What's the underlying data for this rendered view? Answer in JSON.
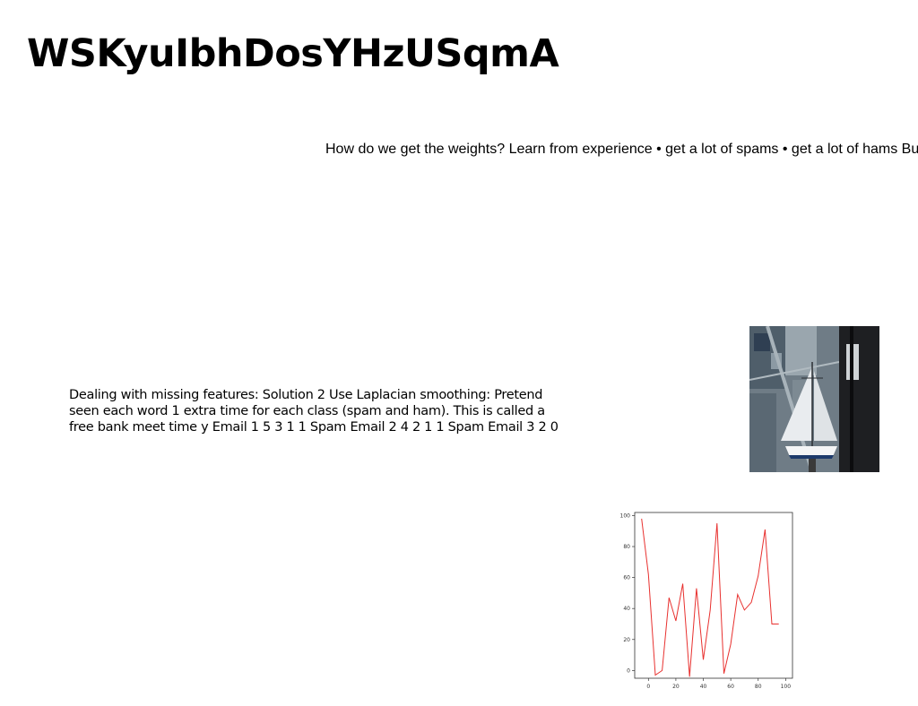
{
  "slide": {
    "title": "WSKyuIbhDosYHzUSqmA",
    "subtitle": "How do we get the weights? Learn from experience • get a lot of spams • get a lot of hams But",
    "body": "Dealing with missing features: Solution 2 Use Laplacian smoothing: Pretend seen each word 1 extra time for each class (spam and ham). This is called a free bank meet time y Email 1 5 3 1 1 Spam Email 2 4 2 1 1 Spam Email 3 2 0"
  },
  "chart_data": {
    "type": "line",
    "x": [
      -5,
      0,
      5,
      10,
      15,
      20,
      25,
      30,
      35,
      40,
      45,
      50,
      55,
      60,
      65,
      70,
      75,
      80,
      85,
      90,
      95,
      100
    ],
    "series": [
      {
        "values": [
          98,
          62,
          -3,
          0,
          47,
          32,
          56,
          -4,
          53,
          7,
          39,
          95,
          -2,
          17,
          49,
          39,
          44,
          61,
          91,
          30,
          30,
          30
        ],
        "color": "#e8312f"
      }
    ],
    "xticks": [
      "0",
      "20",
      "40",
      "60",
      "80",
      "100"
    ],
    "yticks": [
      "0",
      "20",
      "40",
      "60",
      "80",
      "100"
    ],
    "xlim": [
      -10,
      105
    ],
    "ylim": [
      -5,
      102
    ],
    "grid": false
  }
}
